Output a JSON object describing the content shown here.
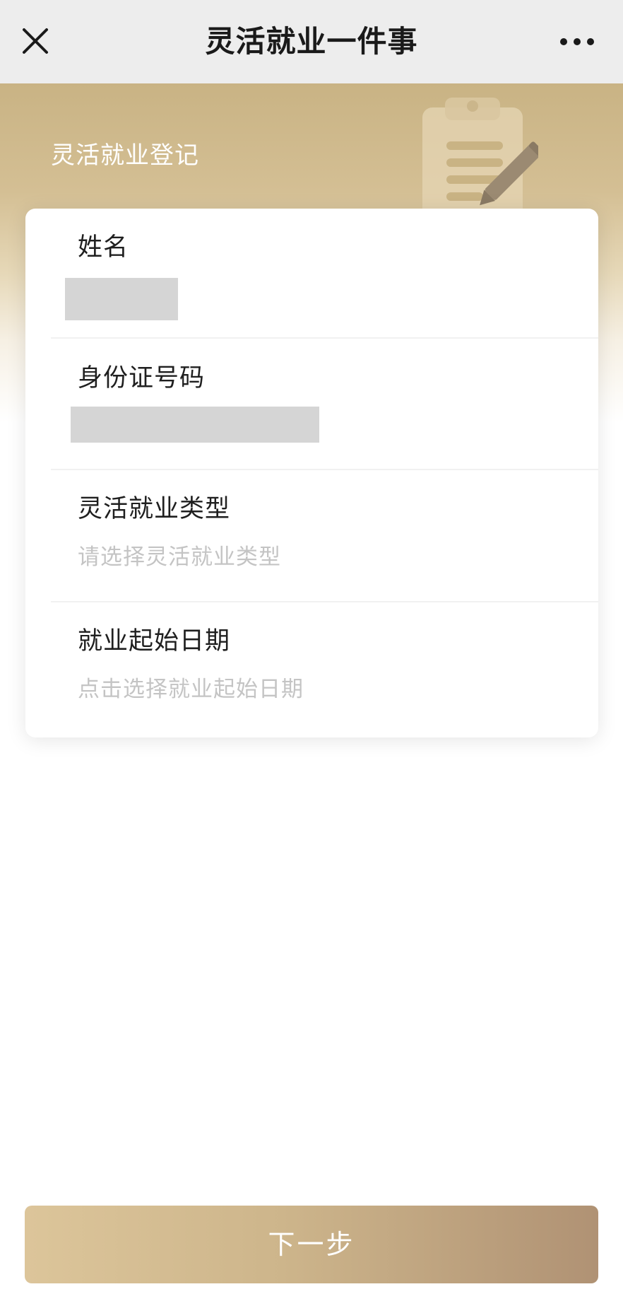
{
  "navbar": {
    "title": "灵活就业一件事",
    "close_icon": "close-icon",
    "more_icon": "more-icon"
  },
  "hero": {
    "title": "灵活就业登记",
    "illustration_icon": "clipboard-pencil-icon"
  },
  "form": {
    "fields": [
      {
        "label": "姓名",
        "value_state": "masked"
      },
      {
        "label": "身份证号码",
        "value_state": "masked"
      },
      {
        "label": "灵活就业类型",
        "placeholder": "请选择灵活就业类型"
      },
      {
        "label": "就业起始日期",
        "placeholder": "点击选择就业起始日期"
      }
    ]
  },
  "footer": {
    "next_label": "下一步"
  },
  "colors": {
    "accent_gold": "#c9b384",
    "button_start": "#dcc59a",
    "button_end": "#b09274",
    "placeholder_text": "#c4c4c4",
    "mask_gray": "#d5d5d5"
  }
}
